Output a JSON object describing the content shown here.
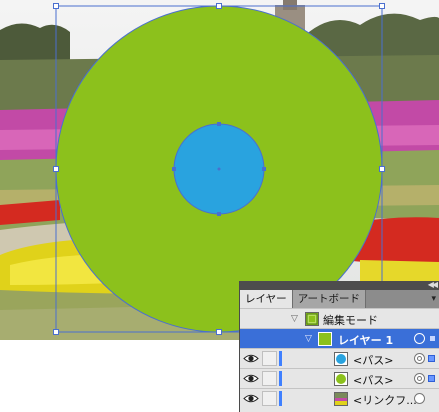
{
  "app": {
    "accent_color": "#3f80ff"
  },
  "artwork": {
    "outer_circle_color": "#8cc11c",
    "inner_circle_color": "#29a3df",
    "selection_color": "#4a6fcf"
  },
  "layers_panel": {
    "tabs": [
      {
        "label": "レイヤー",
        "active": true
      },
      {
        "label": "アートボード",
        "active": false
      }
    ],
    "rows": [
      {
        "kind": "isolation-mode",
        "label": "編集モード",
        "thumb_icon": "layer-thumb-icon"
      },
      {
        "kind": "layer",
        "label": "レイヤー 1",
        "selected": true,
        "visible": true
      },
      {
        "kind": "item",
        "label": "<パス>",
        "thumb_color": "#29a3df",
        "visible": true
      },
      {
        "kind": "item",
        "label": "<パス>",
        "thumb_color": "#8cc11c",
        "visible": true
      },
      {
        "kind": "item",
        "label": "<リンクフ...",
        "thumb_icon": "linked-image-thumb-icon",
        "visible": true
      }
    ]
  }
}
